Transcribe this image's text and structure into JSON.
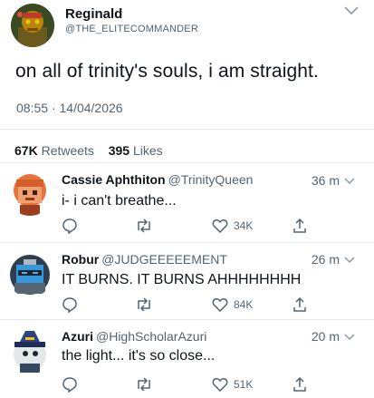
{
  "tweet": {
    "author_name": "Reginald",
    "author_handle": "@THE_ELITECOMMANDER",
    "text": "on all of trinity's souls, i am straight.",
    "time": "08:55",
    "date": "14/04/2026",
    "retweets_count": "67K",
    "retweets_label": "Retweets",
    "likes_count": "395",
    "likes_label": "Likes"
  },
  "replies": [
    {
      "name": "Cassie Aphthiton",
      "handle": "@TrinityQueen",
      "time": "36 m",
      "text": "i- i can't breathe...",
      "likes": "34K",
      "avatar_icon": "orange-haired-avatar-icon"
    },
    {
      "name": "Robur",
      "handle": "@JUDGEEEEEMENT",
      "time": "26 m",
      "text": "IT BURNS. IT BURNS AHHHHHHHH",
      "likes": "84K",
      "avatar_icon": "blue-robot-avatar-icon"
    },
    {
      "name": "Azuri",
      "handle": "@HighScholarAzuri",
      "time": "20 m",
      "text": "the light... it's so close...",
      "likes": "51K",
      "avatar_icon": "wizard-hat-avatar-icon"
    }
  ],
  "colors": {
    "text": "#0f1419",
    "secondary": "#536471",
    "divider": "#e6e9eb",
    "icon": "#1d9bf0"
  }
}
